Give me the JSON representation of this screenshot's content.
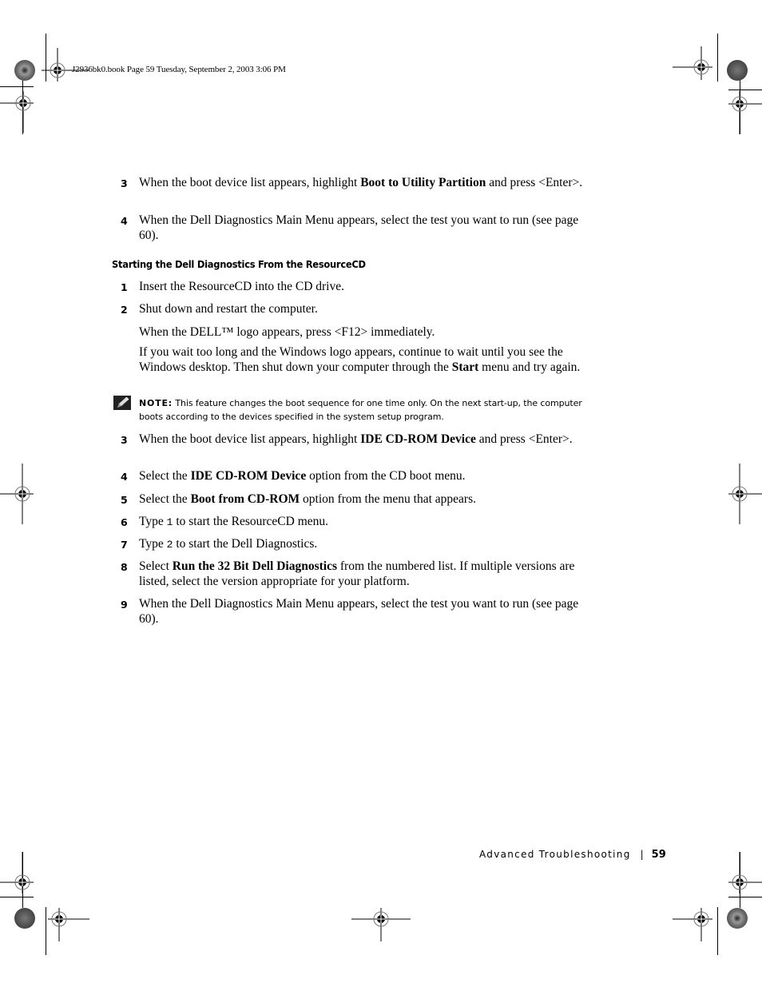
{
  "header": {
    "file_info": "J2936bk0.book  Page 59  Tuesday, September 2, 2003  3:06 PM"
  },
  "steps_a": [
    {
      "num": "3",
      "pre": "When the boot device list appears, highlight ",
      "bold": "Boot to Utility Partition",
      "post": "  and press <Enter>."
    },
    {
      "num": "4",
      "text": "When the Dell Diagnostics Main Menu appears, select the test you want to run (see page 60)."
    }
  ],
  "section": {
    "title": "Starting the Dell Diagnostics From the ResourceCD"
  },
  "steps_b": [
    {
      "num": "1",
      "text": "Insert the ResourceCD into the CD drive."
    },
    {
      "num": "2",
      "text": "Shut down and restart the computer."
    }
  ],
  "paras": {
    "dell_logo": "When the DELL™ logo appears, press <F12> immediately.",
    "wait_pre": "If you wait too long and the Windows logo appears, continue to wait until you see the Windows desktop. Then shut down your computer through the ",
    "wait_bold": "Start",
    "wait_post": " menu and try again."
  },
  "note": {
    "icon": "pencil-note-icon",
    "label": "NOTE:",
    "text": " This feature changes the boot sequence for one time only. On the next start-up, the computer boots according to the devices specified in the system setup program."
  },
  "steps_c": [
    {
      "num": "3",
      "pre": "When the boot device list appears, highlight ",
      "bold": "IDE CD-ROM Device",
      "post": " and press <Enter>."
    },
    {
      "num": "4",
      "pre": "Select the ",
      "bold": "IDE CD-ROM Device",
      "post": " option from the CD boot menu."
    },
    {
      "num": "5",
      "pre": "Select the ",
      "bold": "Boot from CD-ROM",
      "post": " option from the menu that appears."
    },
    {
      "num": "6",
      "pre": "Type ",
      "code": "1",
      "post": " to start the ResourceCD menu."
    },
    {
      "num": "7",
      "pre": "Type ",
      "code": "2",
      "post": " to start the Dell Diagnostics."
    },
    {
      "num": "8",
      "pre": "Select ",
      "bold": "Run the 32 Bit Dell Diagnostics",
      "post": " from the numbered list. If multiple versions are listed, select the version appropriate for your platform."
    },
    {
      "num": "9",
      "text": "When the Dell Diagnostics Main Menu appears, select the test you want to run (see page 60)."
    }
  ],
  "footer": {
    "chapter": "Advanced Troubleshooting",
    "separator": "|",
    "page_number": "59"
  }
}
